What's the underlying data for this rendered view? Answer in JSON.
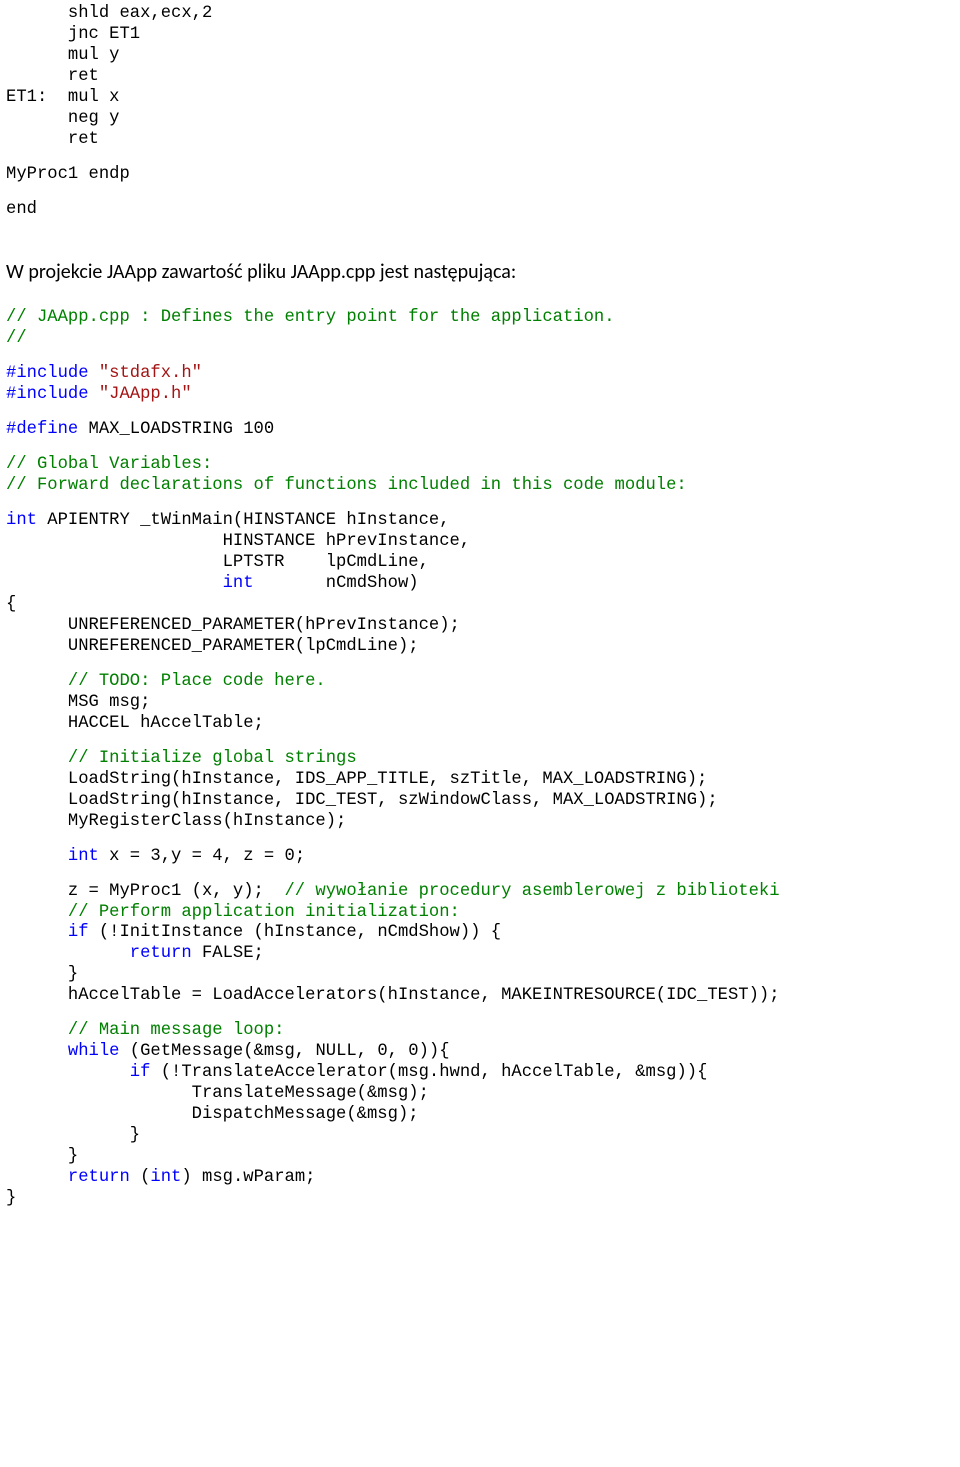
{
  "asm": {
    "l1": "      shld eax,ecx,2",
    "l2": "      jnc ET1",
    "l3": "      mul y",
    "l4": "      ret",
    "l5": "ET1:  mul x",
    "l6": "      neg y",
    "l7": "      ret",
    "l8": "MyProc1 endp",
    "l9": "end"
  },
  "prose1": "W projekcie JAApp zawartość pliku JAApp.cpp jest następująca:",
  "c": {
    "c01": "// JAApp.cpp : Defines the entry point for the application.",
    "c02": "//",
    "c03a": "#include",
    "c03b": " ",
    "c03c": "\"stdafx.h\"",
    "c04a": "#include",
    "c04b": " ",
    "c04c": "\"JAApp.h\"",
    "c05a": "#define",
    "c05b": " MAX_LOADSTRING 100",
    "c06": "// Global Variables:",
    "c07": "// Forward declarations of functions included in this code module:",
    "c08a": "int",
    "c08b": " APIENTRY _tWinMain(HINSTANCE hInstance,",
    "c09": "                     HINSTANCE hPrevInstance,",
    "c10": "                     LPTSTR    lpCmdLine,",
    "c11a": "                     ",
    "c11b": "int",
    "c11c": "       nCmdShow)",
    "c12": "{",
    "c13": "      UNREFERENCED_PARAMETER(hPrevInstance);",
    "c14": "      UNREFERENCED_PARAMETER(lpCmdLine);",
    "c15": "      // TODO: Place code here.",
    "c16": "      MSG msg;",
    "c17": "      HACCEL hAccelTable;",
    "c18": "      // Initialize global strings",
    "c19": "      LoadString(hInstance, IDS_APP_TITLE, szTitle, MAX_LOADSTRING);",
    "c20": "      LoadString(hInstance, IDC_TEST, szWindowClass, MAX_LOADSTRING);",
    "c21": "      MyRegisterClass(hInstance);",
    "c22a": "      ",
    "c22b": "int",
    "c22c": " x = 3,y = 4, z = 0;",
    "c23a": "      z = MyProc1 (x, y);  ",
    "c23b": "// wywołanie procedury asemblerowej z biblioteki",
    "c24": "      // Perform application initialization:",
    "c25a": "      ",
    "c25b": "if",
    "c25c": " (!InitInstance (hInstance, nCmdShow)) {",
    "c26a": "            ",
    "c26b": "return",
    "c26c": " FALSE;",
    "c27": "      }",
    "c28": "      hAccelTable = LoadAccelerators(hInstance, MAKEINTRESOURCE(IDC_TEST));",
    "c29": "      // Main message loop:",
    "c30a": "      ",
    "c30b": "while",
    "c30c": " (GetMessage(&msg, NULL, 0, 0)){",
    "c31a": "            ",
    "c31b": "if",
    "c31c": " (!TranslateAccelerator(msg.hwnd, hAccelTable, &msg)){",
    "c32": "                  TranslateMessage(&msg);",
    "c33": "                  DispatchMessage(&msg);",
    "c34": "            }",
    "c35": "      }",
    "c36a": "      ",
    "c36b": "return",
    "c36c": " (",
    "c36d": "int",
    "c36e": ") msg.wParam;",
    "c37": "}"
  }
}
